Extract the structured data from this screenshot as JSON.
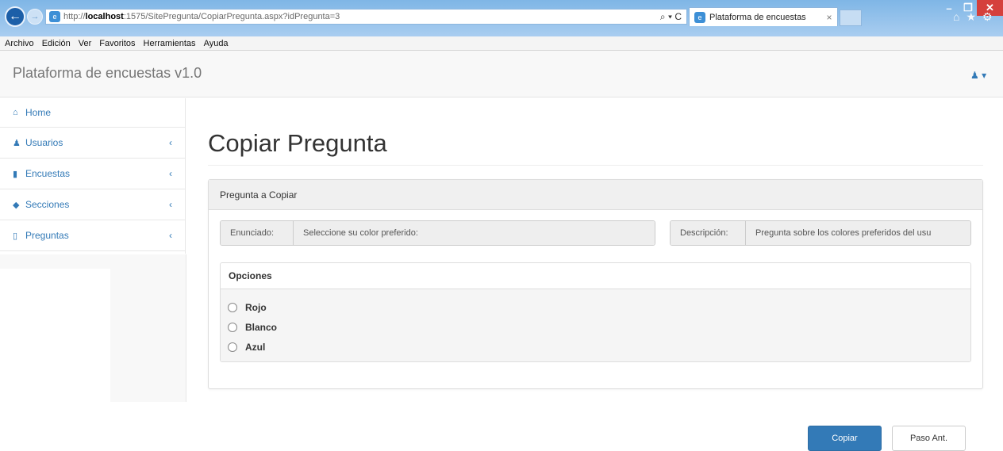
{
  "browser": {
    "url_prefix": "http://",
    "url_host": "localhost",
    "url_rest": ":1575/SitePregunta/CopiarPregunta.aspx?idPregunta=3",
    "search_tools": "⌕ ▾ C",
    "tab_title": "Plataforma de encuestas",
    "tab_close": "×",
    "back": "←",
    "forward": "→",
    "win_min": "–",
    "win_max": "❐",
    "win_close": "✕",
    "menu": [
      "Archivo",
      "Edición",
      "Ver",
      "Favoritos",
      "Herramientas",
      "Ayuda"
    ]
  },
  "header": {
    "brand": "Plataforma de encuestas v1.0",
    "user_menu": "▾"
  },
  "sidebar": {
    "items": [
      {
        "label": "Home",
        "icon": "home-icon"
      },
      {
        "label": "Usuarios",
        "icon": "users-icon"
      },
      {
        "label": "Encuestas",
        "icon": "bookmark-icon"
      },
      {
        "label": "Secciones",
        "icon": "tags-icon"
      },
      {
        "label": "Preguntas",
        "icon": "bookmark-outline-icon"
      }
    ],
    "chevron": "‹"
  },
  "main": {
    "title": "Copiar Pregunta",
    "panel_heading": "Pregunta a Copiar",
    "enunciado_label": "Enunciado:",
    "enunciado_value": "Seleccione su color preferido:",
    "descripcion_label": "Descripción:",
    "descripcion_value": "Pregunta sobre los colores preferidos del usu",
    "options_heading": "Opciones",
    "options": [
      "Rojo",
      "Blanco",
      "Azul"
    ]
  },
  "buttons": {
    "copiar": "Copiar",
    "paso_ant": "Paso Ant."
  }
}
